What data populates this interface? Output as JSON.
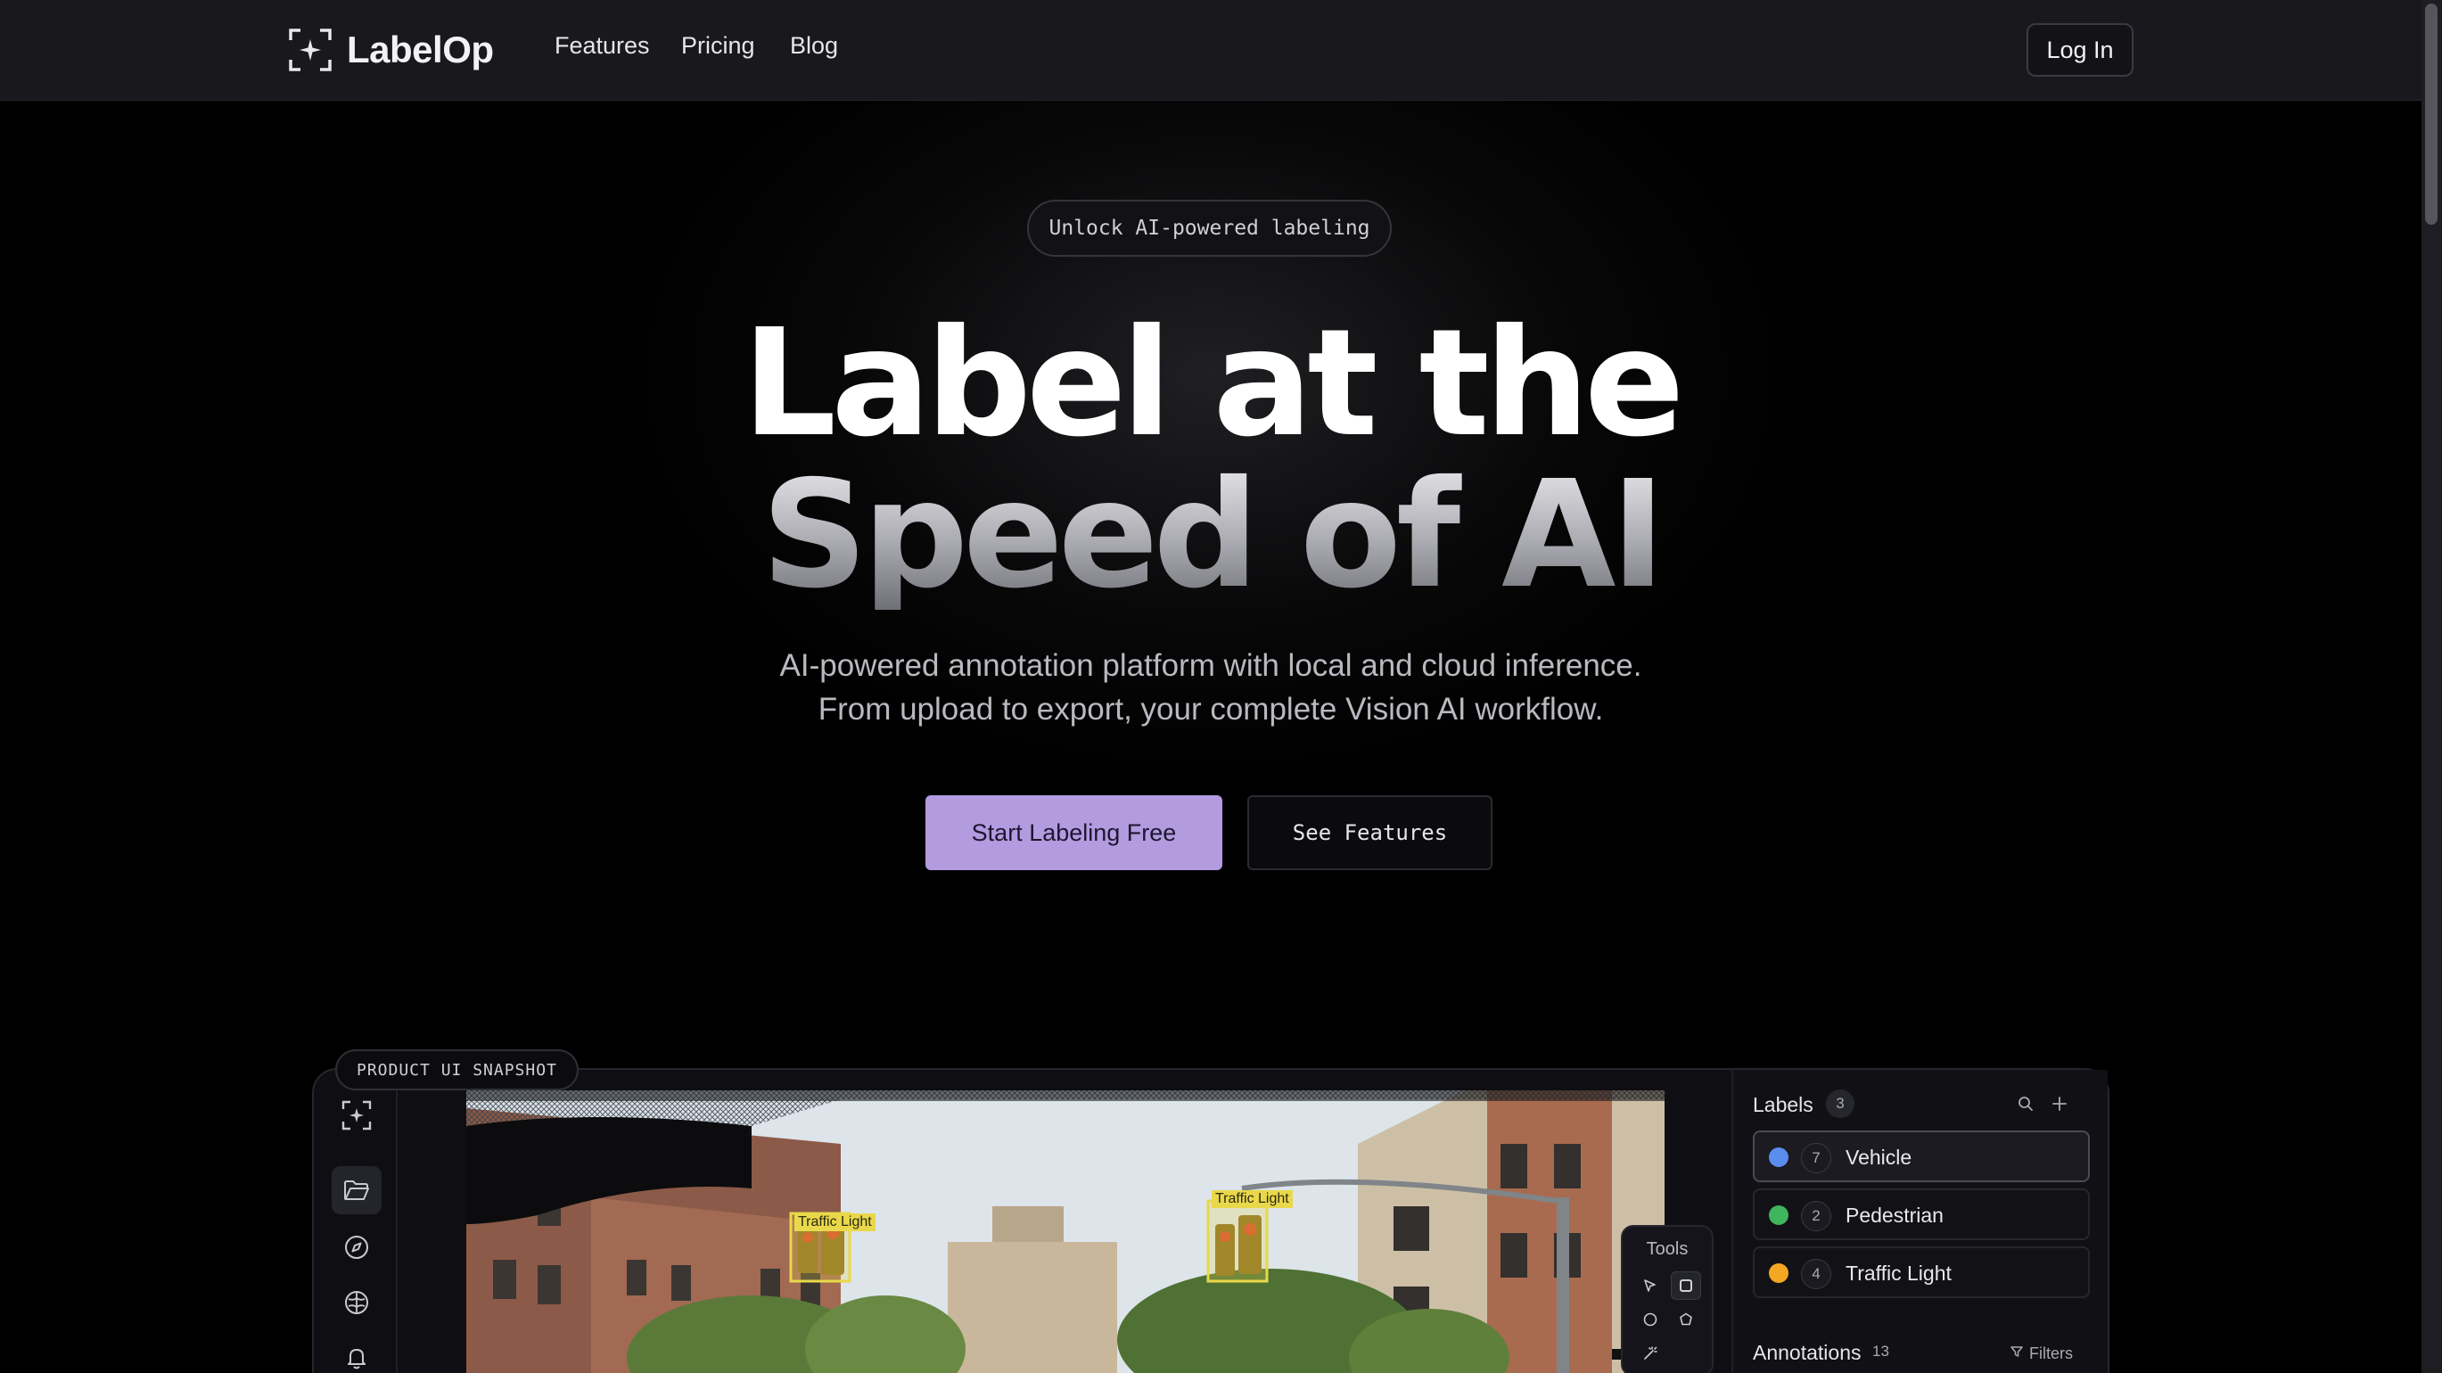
{
  "brand": {
    "name": "LabelOp"
  },
  "nav": {
    "links": [
      "Features",
      "Pricing",
      "Blog"
    ],
    "login_label": "Log In"
  },
  "hero": {
    "pill": "Unlock AI-powered labeling",
    "title_line1": "Label at the",
    "title_line2": "Speed of AI",
    "subtitle_line1": "AI-powered annotation platform with local and cloud inference.",
    "subtitle_line2": "From upload to export, your complete Vision AI workflow.",
    "primary_cta": "Start Labeling Free",
    "secondary_cta": "See Features"
  },
  "snapshot": {
    "tag": "PRODUCT UI SNAPSHOT",
    "tools_title": "Tools",
    "image_tags": [
      "Traffic Light",
      "Traffic Light"
    ],
    "labels_panel": {
      "title": "Labels",
      "count": "3",
      "items": [
        {
          "count": "7",
          "name": "Vehicle",
          "color": "#5b8def"
        },
        {
          "count": "2",
          "name": "Pedestrian",
          "color": "#3fb55d"
        },
        {
          "count": "4",
          "name": "Traffic Light",
          "color": "#f5a623"
        }
      ]
    },
    "annotations": {
      "title": "Annotations",
      "count": "13",
      "filters_label": "Filters"
    }
  },
  "colors": {
    "accent": "#b39be0",
    "background": "#000000",
    "navbar": "#18181d"
  }
}
